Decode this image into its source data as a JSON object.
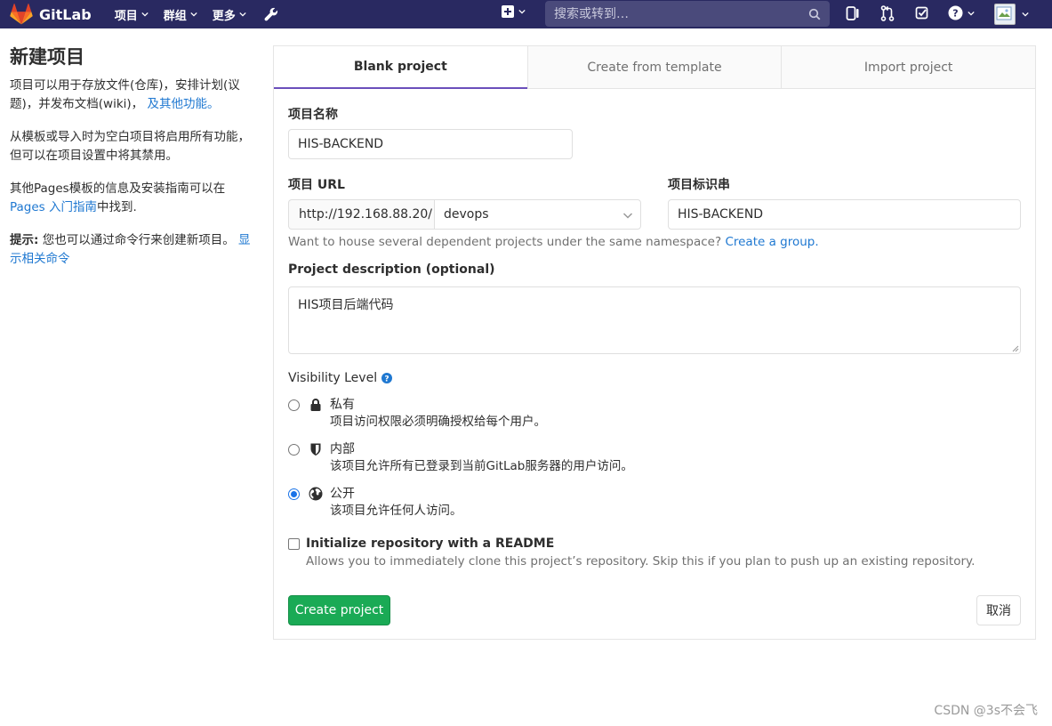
{
  "navbar": {
    "brand": "GitLab",
    "links": [
      {
        "label": "项目"
      },
      {
        "label": "群组"
      },
      {
        "label": "更多"
      }
    ],
    "search_placeholder": "搜索或转到…",
    "icons": [
      "plus-icon",
      "search-icon",
      "board-icon",
      "merge-request-icon",
      "todo-icon",
      "help-icon",
      "avatar"
    ]
  },
  "sidebar": {
    "title": "新建项目",
    "intro_text": "项目可以用于存放文件(仓库)，安排计划(议题)，并发布文档(wiki)，",
    "intro_link": "及其他功能。",
    "template_text": "从模板或导入时为空白项目将启用所有功能，但可以在项目设置中将其禁用。",
    "pages_text_before": "其他Pages模板的信息及安装指南可以在",
    "pages_link": "Pages 入门指南",
    "pages_text_after": "中找到.",
    "tip_label": "提示:",
    "tip_text": "您也可以通过命令行来创建新项目。",
    "tip_link": "显示相关命令"
  },
  "tabs": [
    {
      "label": "Blank project",
      "active": true
    },
    {
      "label": "Create from template",
      "active": false
    },
    {
      "label": "Import project",
      "active": false
    }
  ],
  "form": {
    "name_label": "项目名称",
    "name_value": "HIS-BACKEND",
    "url_label": "项目 URL",
    "url_prefix": "http://192.168.88.20/",
    "namespace": "devops",
    "slug_label": "项目标识串",
    "slug_value": "HIS-BACKEND",
    "group_help": "Want to house several dependent projects under the same namespace?",
    "group_link": "Create a group.",
    "desc_label": "Project description (optional)",
    "desc_value": "HIS项目后端代码",
    "visibility_label": "Visibility Level",
    "visibility": [
      {
        "title": "私有",
        "desc": "项目访问权限必须明确授权给每个用户。",
        "icon": "lock-icon",
        "checked": false
      },
      {
        "title": "内部",
        "desc": "该项目允许所有已登录到当前GitLab服务器的用户访问。",
        "icon": "shield-icon",
        "checked": false
      },
      {
        "title": "公开",
        "desc": "该项目允许任何人访问。",
        "icon": "globe-icon",
        "checked": true
      }
    ],
    "readme_label": "Initialize repository with a README",
    "readme_help": "Allows you to immediately clone this project’s repository. Skip this if you plan to push up an existing repository.",
    "readme_checked": false,
    "create_label": "Create project",
    "cancel_label": "取消"
  },
  "watermark": "CSDN @3s不会飞",
  "colors": {
    "navbar": "#292961",
    "accent": "#1f78d1",
    "create_button": "#1aaa55",
    "active_tab_border": "#6b4fbb"
  }
}
